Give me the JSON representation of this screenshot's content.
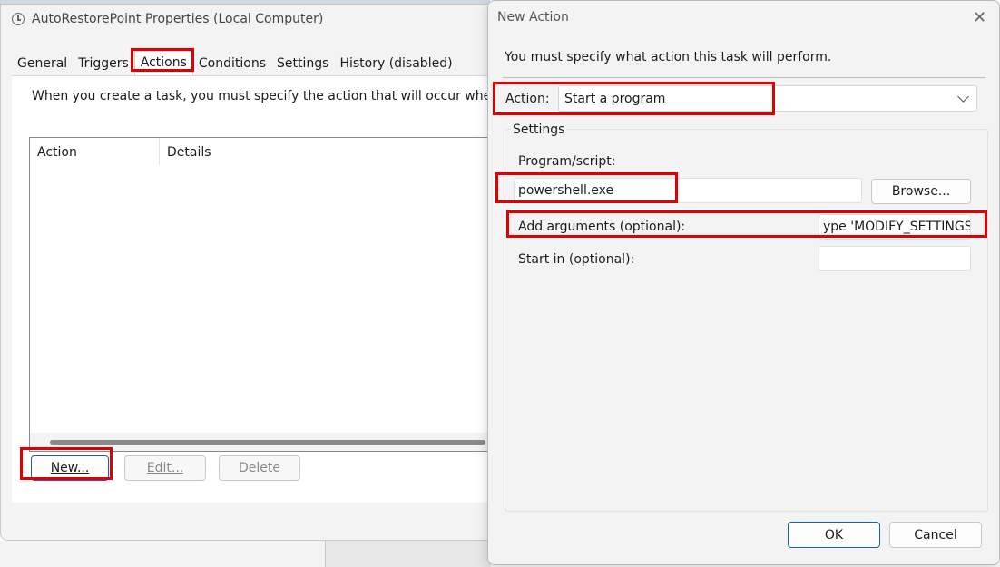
{
  "props_window": {
    "title": "AutoRestorePoint Properties (Local Computer)",
    "tabs": [
      "General",
      "Triggers",
      "Actions",
      "Conditions",
      "Settings",
      "History (disabled)"
    ],
    "active_tab": "Actions",
    "instruction": "When you create a task, you must specify the action that will occur when yo",
    "columns": [
      "Action",
      "Details"
    ],
    "buttons": {
      "new": "New...",
      "edit": "Edit...",
      "delete": "Delete"
    }
  },
  "new_action_dialog": {
    "title": "New Action",
    "close_glyph": "✕",
    "prompt": "You must specify what action this task will perform.",
    "action_label": "Action:",
    "action_value": "Start a program",
    "settings_legend": "Settings",
    "program_label": "Program/script:",
    "program_value": "powershell.exe",
    "browse_label": "Browse...",
    "args_label": "Add arguments (optional):",
    "args_value": "ype 'MODIFY_SETTINGS'\"",
    "startin_label": "Start in (optional):",
    "startin_value": "",
    "ok_label": "OK",
    "cancel_label": "Cancel"
  },
  "colors": {
    "highlight": "#e00000",
    "accent": "#1a5fb4"
  }
}
